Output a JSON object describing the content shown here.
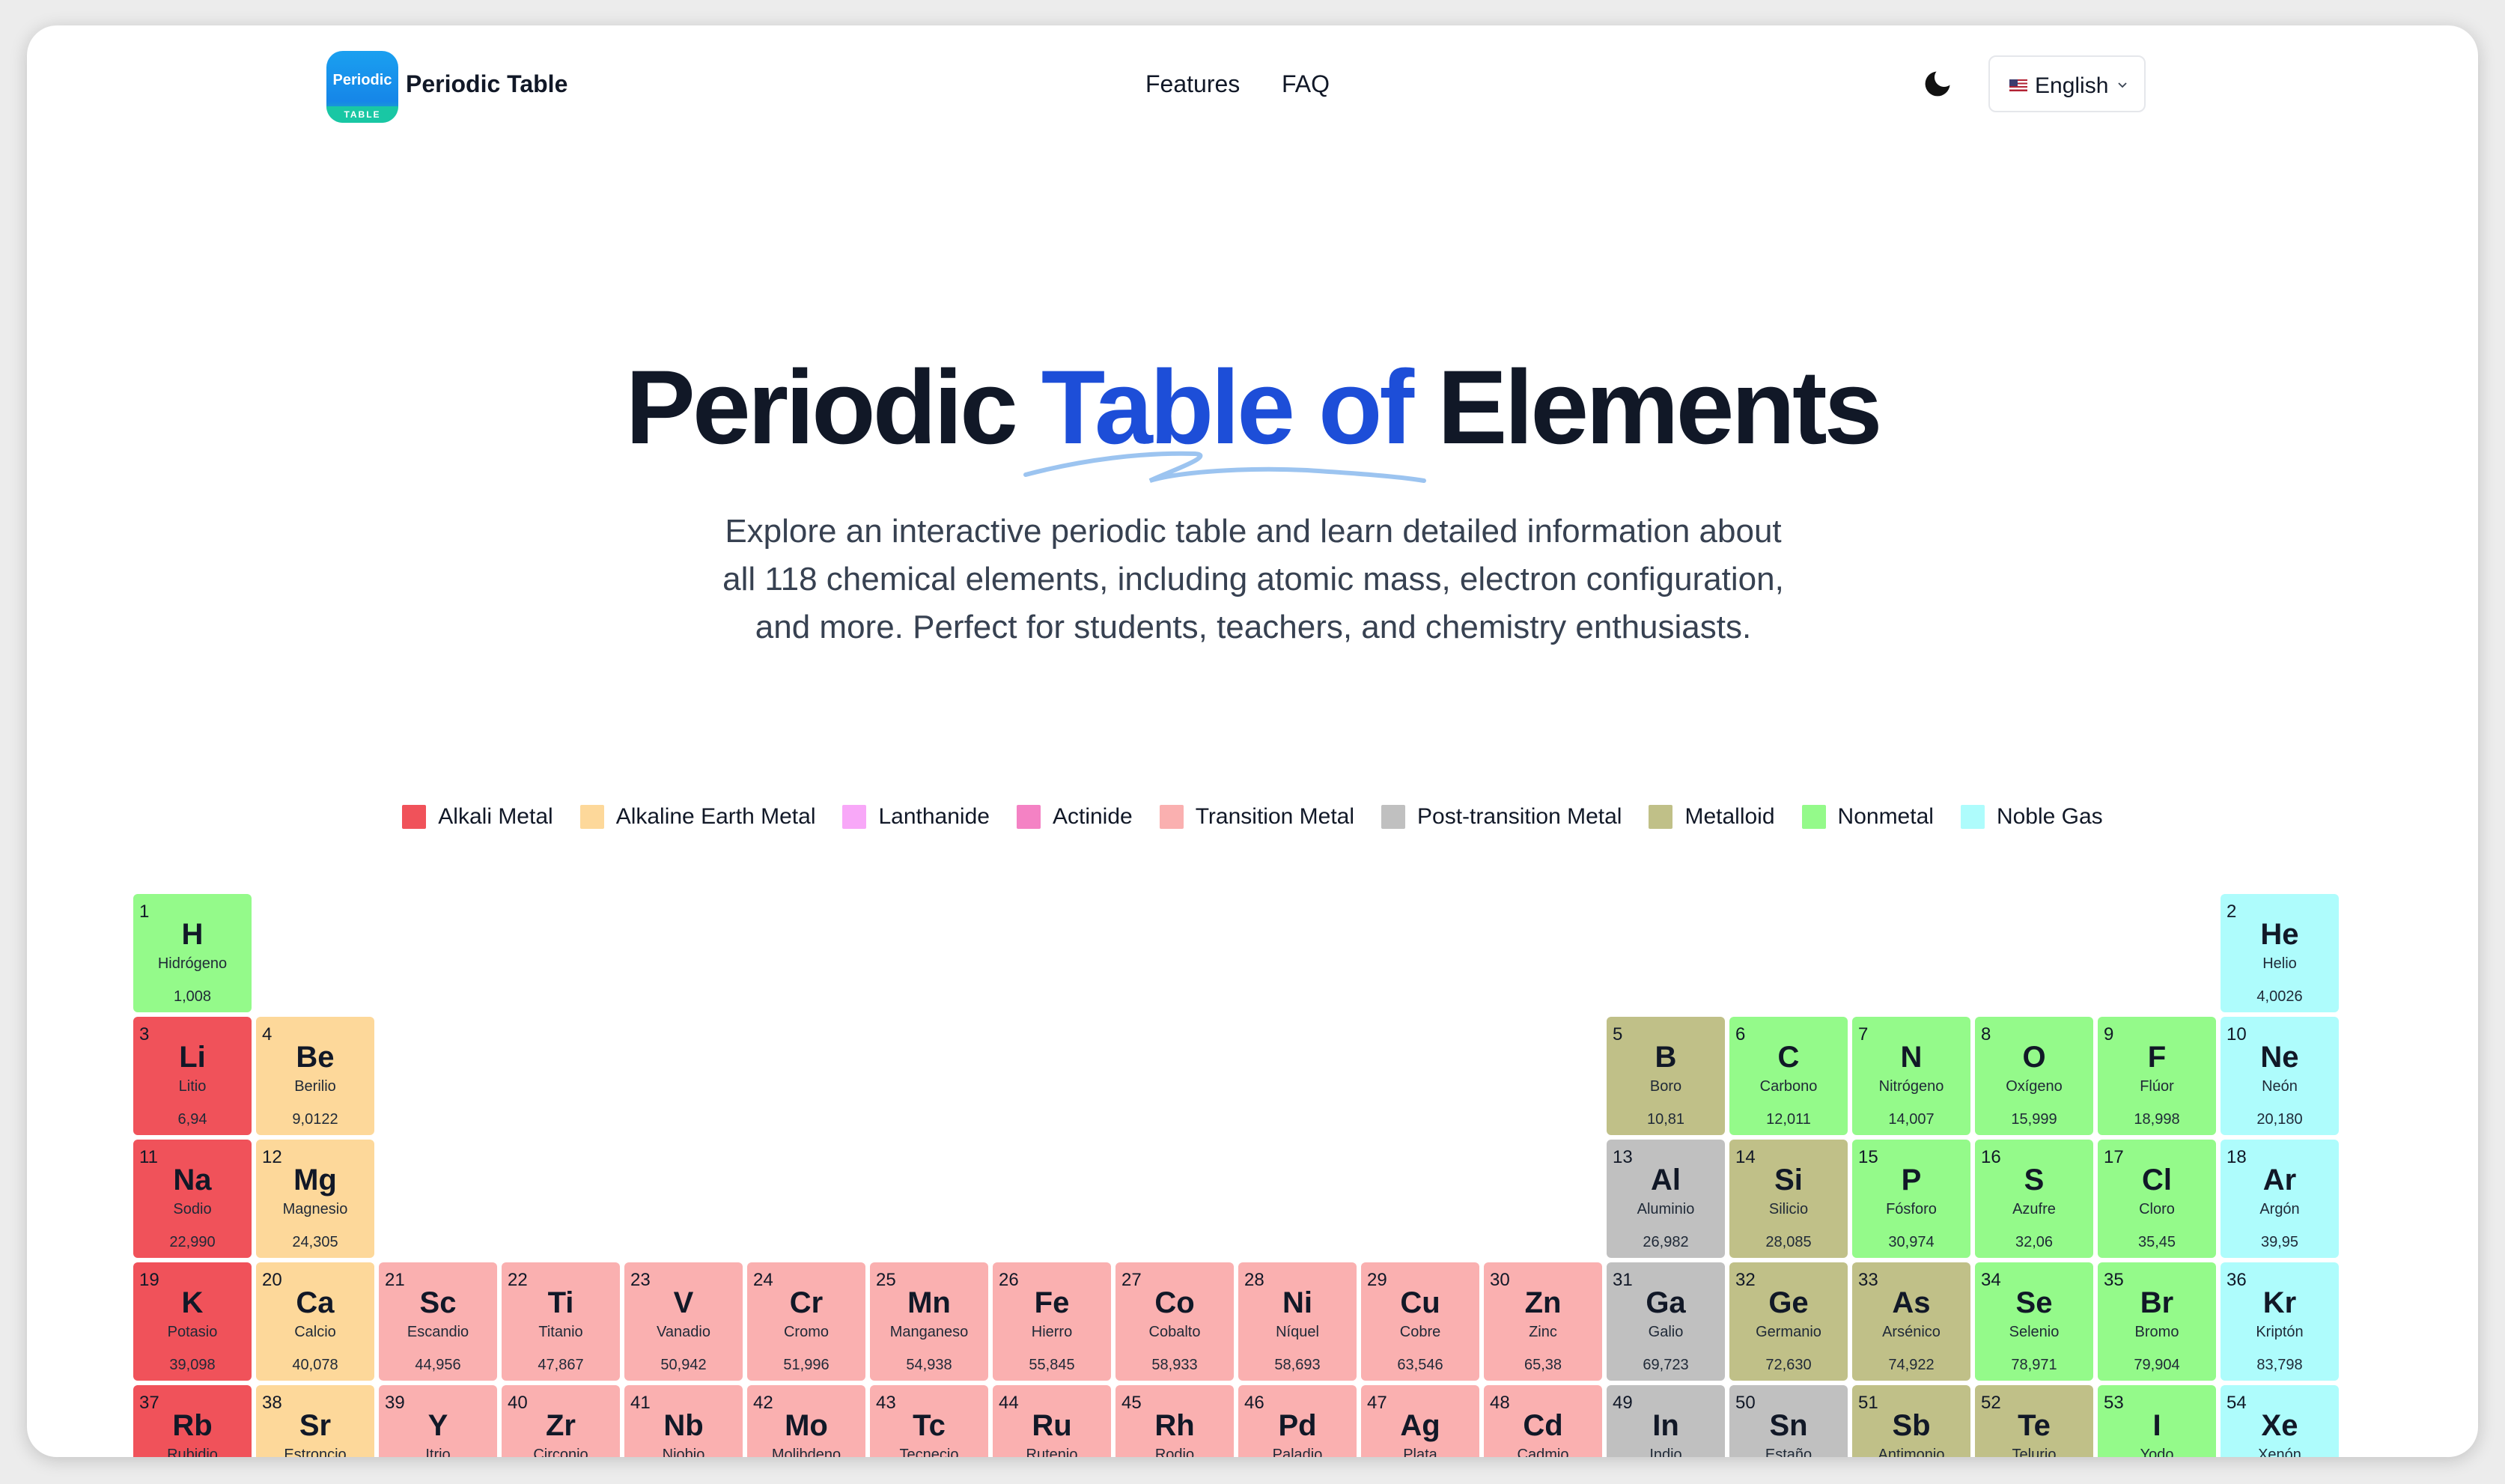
{
  "header": {
    "logo_text": "Periodic",
    "logo_subtext": "TABLE",
    "brand": "Periodic Table",
    "nav": [
      "Features",
      "FAQ"
    ],
    "language": "English"
  },
  "hero": {
    "title_part1": "Periodic ",
    "title_highlight": "Table of",
    "title_part2": " Elements",
    "subtitle": "Explore an interactive periodic table and learn detailed information about all 118 chemical elements, including atomic mass, electron configuration, and more. Perfect for students, teachers, and chemistry enthusiasts."
  },
  "legend": [
    {
      "label": "Alkali Metal",
      "color": "#f0525a"
    },
    {
      "label": "Alkaline Earth Metal",
      "color": "#fdd89a"
    },
    {
      "label": "Lanthanide",
      "color": "#f8a8f8"
    },
    {
      "label": "Actinide",
      "color": "#f482c4"
    },
    {
      "label": "Transition Metal",
      "color": "#fab0b0"
    },
    {
      "label": "Post-transition Metal",
      "color": "#c0c0c0"
    },
    {
      "label": "Metalloid",
      "color": "#c0c088"
    },
    {
      "label": "Nonmetal",
      "color": "#94fa8a"
    },
    {
      "label": "Noble Gas",
      "color": "#aefcfc"
    }
  ],
  "elements": [
    {
      "n": "1",
      "s": "H",
      "name": "Hidrógeno",
      "mass": "1,008",
      "cat": "Nonmetal",
      "col": 1,
      "row": 1
    },
    {
      "n": "2",
      "s": "He",
      "name": "Helio",
      "mass": "4,0026",
      "cat": "Noble Gas",
      "col": 18,
      "row": 1
    },
    {
      "n": "3",
      "s": "Li",
      "name": "Litio",
      "mass": "6,94",
      "cat": "Alkali Metal",
      "col": 1,
      "row": 2
    },
    {
      "n": "4",
      "s": "Be",
      "name": "Berilio",
      "mass": "9,0122",
      "cat": "Alkaline Earth Metal",
      "col": 2,
      "row": 2
    },
    {
      "n": "5",
      "s": "B",
      "name": "Boro",
      "mass": "10,81",
      "cat": "Metalloid",
      "col": 13,
      "row": 2
    },
    {
      "n": "6",
      "s": "C",
      "name": "Carbono",
      "mass": "12,011",
      "cat": "Nonmetal",
      "col": 14,
      "row": 2
    },
    {
      "n": "7",
      "s": "N",
      "name": "Nitrógeno",
      "mass": "14,007",
      "cat": "Nonmetal",
      "col": 15,
      "row": 2
    },
    {
      "n": "8",
      "s": "O",
      "name": "Oxígeno",
      "mass": "15,999",
      "cat": "Nonmetal",
      "col": 16,
      "row": 2
    },
    {
      "n": "9",
      "s": "F",
      "name": "Flúor",
      "mass": "18,998",
      "cat": "Nonmetal",
      "col": 17,
      "row": 2
    },
    {
      "n": "10",
      "s": "Ne",
      "name": "Neón",
      "mass": "20,180",
      "cat": "Noble Gas",
      "col": 18,
      "row": 2
    },
    {
      "n": "11",
      "s": "Na",
      "name": "Sodio",
      "mass": "22,990",
      "cat": "Alkali Metal",
      "col": 1,
      "row": 3
    },
    {
      "n": "12",
      "s": "Mg",
      "name": "Magnesio",
      "mass": "24,305",
      "cat": "Alkaline Earth Metal",
      "col": 2,
      "row": 3
    },
    {
      "n": "13",
      "s": "Al",
      "name": "Aluminio",
      "mass": "26,982",
      "cat": "Post-transition Metal",
      "col": 13,
      "row": 3
    },
    {
      "n": "14",
      "s": "Si",
      "name": "Silicio",
      "mass": "28,085",
      "cat": "Metalloid",
      "col": 14,
      "row": 3
    },
    {
      "n": "15",
      "s": "P",
      "name": "Fósforo",
      "mass": "30,974",
      "cat": "Nonmetal",
      "col": 15,
      "row": 3
    },
    {
      "n": "16",
      "s": "S",
      "name": "Azufre",
      "mass": "32,06",
      "cat": "Nonmetal",
      "col": 16,
      "row": 3
    },
    {
      "n": "17",
      "s": "Cl",
      "name": "Cloro",
      "mass": "35,45",
      "cat": "Nonmetal",
      "col": 17,
      "row": 3
    },
    {
      "n": "18",
      "s": "Ar",
      "name": "Argón",
      "mass": "39,95",
      "cat": "Noble Gas",
      "col": 18,
      "row": 3
    },
    {
      "n": "19",
      "s": "K",
      "name": "Potasio",
      "mass": "39,098",
      "cat": "Alkali Metal",
      "col": 1,
      "row": 4
    },
    {
      "n": "20",
      "s": "Ca",
      "name": "Calcio",
      "mass": "40,078",
      "cat": "Alkaline Earth Metal",
      "col": 2,
      "row": 4
    },
    {
      "n": "21",
      "s": "Sc",
      "name": "Escandio",
      "mass": "44,956",
      "cat": "Transition Metal",
      "col": 3,
      "row": 4
    },
    {
      "n": "22",
      "s": "Ti",
      "name": "Titanio",
      "mass": "47,867",
      "cat": "Transition Metal",
      "col": 4,
      "row": 4
    },
    {
      "n": "23",
      "s": "V",
      "name": "Vanadio",
      "mass": "50,942",
      "cat": "Transition Metal",
      "col": 5,
      "row": 4
    },
    {
      "n": "24",
      "s": "Cr",
      "name": "Cromo",
      "mass": "51,996",
      "cat": "Transition Metal",
      "col": 6,
      "row": 4
    },
    {
      "n": "25",
      "s": "Mn",
      "name": "Manganeso",
      "mass": "54,938",
      "cat": "Transition Metal",
      "col": 7,
      "row": 4
    },
    {
      "n": "26",
      "s": "Fe",
      "name": "Hierro",
      "mass": "55,845",
      "cat": "Transition Metal",
      "col": 8,
      "row": 4
    },
    {
      "n": "27",
      "s": "Co",
      "name": "Cobalto",
      "mass": "58,933",
      "cat": "Transition Metal",
      "col": 9,
      "row": 4
    },
    {
      "n": "28",
      "s": "Ni",
      "name": "Níquel",
      "mass": "58,693",
      "cat": "Transition Metal",
      "col": 10,
      "row": 4
    },
    {
      "n": "29",
      "s": "Cu",
      "name": "Cobre",
      "mass": "63,546",
      "cat": "Transition Metal",
      "col": 11,
      "row": 4
    },
    {
      "n": "30",
      "s": "Zn",
      "name": "Zinc",
      "mass": "65,38",
      "cat": "Transition Metal",
      "col": 12,
      "row": 4
    },
    {
      "n": "31",
      "s": "Ga",
      "name": "Galio",
      "mass": "69,723",
      "cat": "Post-transition Metal",
      "col": 13,
      "row": 4
    },
    {
      "n": "32",
      "s": "Ge",
      "name": "Germanio",
      "mass": "72,630",
      "cat": "Metalloid",
      "col": 14,
      "row": 4
    },
    {
      "n": "33",
      "s": "As",
      "name": "Arsénico",
      "mass": "74,922",
      "cat": "Metalloid",
      "col": 15,
      "row": 4
    },
    {
      "n": "34",
      "s": "Se",
      "name": "Selenio",
      "mass": "78,971",
      "cat": "Nonmetal",
      "col": 16,
      "row": 4
    },
    {
      "n": "35",
      "s": "Br",
      "name": "Bromo",
      "mass": "79,904",
      "cat": "Nonmetal",
      "col": 17,
      "row": 4
    },
    {
      "n": "36",
      "s": "Kr",
      "name": "Kriptón",
      "mass": "83,798",
      "cat": "Noble Gas",
      "col": 18,
      "row": 4
    },
    {
      "n": "37",
      "s": "Rb",
      "name": "Rubidio",
      "mass": "",
      "cat": "Alkali Metal",
      "col": 1,
      "row": 5
    },
    {
      "n": "38",
      "s": "Sr",
      "name": "Estroncio",
      "mass": "",
      "cat": "Alkaline Earth Metal",
      "col": 2,
      "row": 5
    },
    {
      "n": "39",
      "s": "Y",
      "name": "Itrio",
      "mass": "",
      "cat": "Transition Metal",
      "col": 3,
      "row": 5
    },
    {
      "n": "40",
      "s": "Zr",
      "name": "Circonio",
      "mass": "",
      "cat": "Transition Metal",
      "col": 4,
      "row": 5
    },
    {
      "n": "41",
      "s": "Nb",
      "name": "Niobio",
      "mass": "",
      "cat": "Transition Metal",
      "col": 5,
      "row": 5
    },
    {
      "n": "42",
      "s": "Mo",
      "name": "Molibdeno",
      "mass": "",
      "cat": "Transition Metal",
      "col": 6,
      "row": 5
    },
    {
      "n": "43",
      "s": "Tc",
      "name": "Tecnecio",
      "mass": "",
      "cat": "Transition Metal",
      "col": 7,
      "row": 5
    },
    {
      "n": "44",
      "s": "Ru",
      "name": "Rutenio",
      "mass": "",
      "cat": "Transition Metal",
      "col": 8,
      "row": 5
    },
    {
      "n": "45",
      "s": "Rh",
      "name": "Rodio",
      "mass": "",
      "cat": "Transition Metal",
      "col": 9,
      "row": 5
    },
    {
      "n": "46",
      "s": "Pd",
      "name": "Paladio",
      "mass": "",
      "cat": "Transition Metal",
      "col": 10,
      "row": 5
    },
    {
      "n": "47",
      "s": "Ag",
      "name": "Plata",
      "mass": "",
      "cat": "Transition Metal",
      "col": 11,
      "row": 5
    },
    {
      "n": "48",
      "s": "Cd",
      "name": "Cadmio",
      "mass": "",
      "cat": "Transition Metal",
      "col": 12,
      "row": 5
    },
    {
      "n": "49",
      "s": "In",
      "name": "Indio",
      "mass": "",
      "cat": "Post-transition Metal",
      "col": 13,
      "row": 5
    },
    {
      "n": "50",
      "s": "Sn",
      "name": "Estaño",
      "mass": "",
      "cat": "Post-transition Metal",
      "col": 14,
      "row": 5
    },
    {
      "n": "51",
      "s": "Sb",
      "name": "Antimonio",
      "mass": "",
      "cat": "Metalloid",
      "col": 15,
      "row": 5
    },
    {
      "n": "52",
      "s": "Te",
      "name": "Telurio",
      "mass": "",
      "cat": "Metalloid",
      "col": 16,
      "row": 5
    },
    {
      "n": "53",
      "s": "I",
      "name": "Yodo",
      "mass": "",
      "cat": "Nonmetal",
      "col": 17,
      "row": 5
    },
    {
      "n": "54",
      "s": "Xe",
      "name": "Xenón",
      "mass": "",
      "cat": "Noble Gas",
      "col": 18,
      "row": 5
    }
  ]
}
